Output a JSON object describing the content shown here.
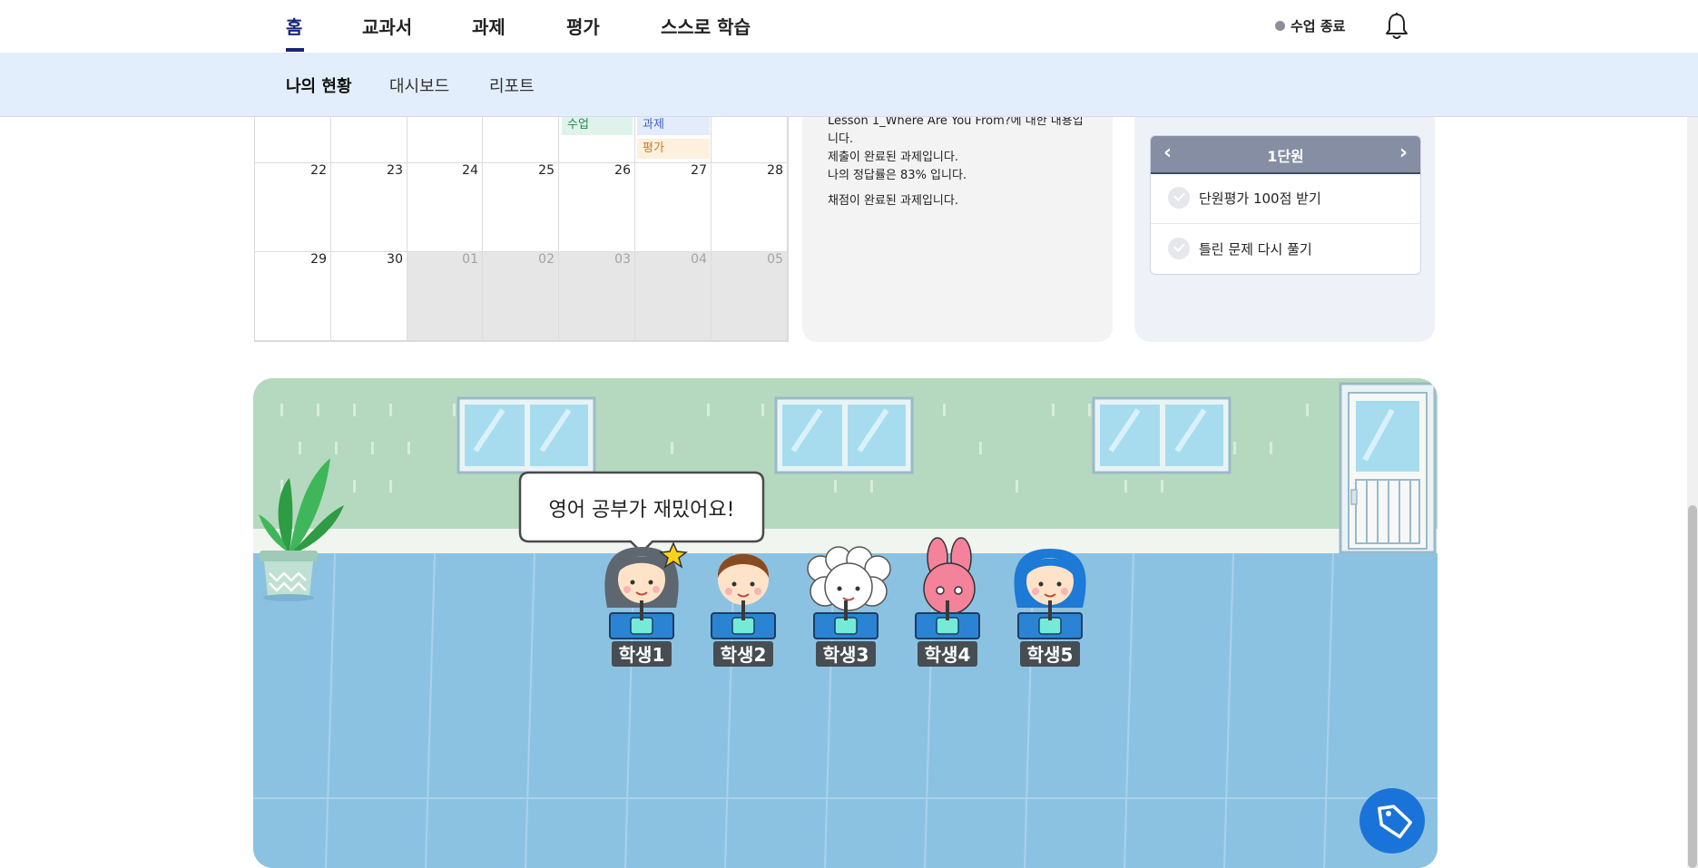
{
  "nav": {
    "items": [
      "홈",
      "교과서",
      "과제",
      "평가",
      "스스로 학습"
    ],
    "active_index": 0,
    "end_class_label": "수업 종료"
  },
  "subnav": {
    "items": [
      "나의 현황",
      "대시보드",
      "리포트"
    ],
    "active_index": 0
  },
  "calendar": {
    "tags": {
      "lesson": "수업",
      "homework": "과제",
      "eval": "평가"
    },
    "weeks": [
      [
        "22",
        "23",
        "24",
        "25",
        "26",
        "27",
        "28"
      ],
      [
        "29",
        "30",
        "01",
        "02",
        "03",
        "04",
        "05"
      ]
    ]
  },
  "detail": {
    "lines": [
      "Lesson 1_Where Are You From?에 대한 내용입",
      "니다.",
      "제출이 완료된 과제입니다.",
      "나의 정답률은 83% 입니다.",
      "채점이 완료된 과제입니다."
    ]
  },
  "goals": {
    "unit": "1단원",
    "items": [
      "단원평가 100점 받기",
      "틀린 문제 다시 풀기"
    ]
  },
  "classroom": {
    "speech": "영어 공부가 재밌어요!",
    "students": [
      "학생1",
      "학생2",
      "학생3",
      "학생4",
      "학생5"
    ]
  },
  "colors": {
    "accent": "#17257c",
    "subnav_bg": "#e3eefc",
    "wall": "#b5d9bf",
    "floor": "#8cc2e1",
    "tag_button": "#1a73d9"
  }
}
